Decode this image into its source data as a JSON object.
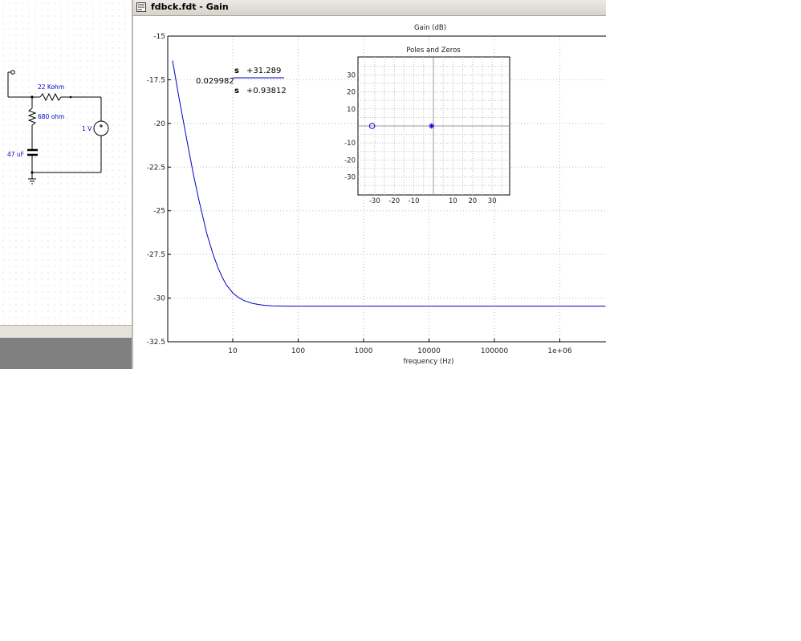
{
  "window": {
    "title": "fdbck.fdt - Gain"
  },
  "schematic": {
    "components": [
      {
        "label": "22 Kohm"
      },
      {
        "label": "680 ohm"
      },
      {
        "label": "47 uF"
      },
      {
        "label": "1 V"
      }
    ]
  },
  "transfer_function": {
    "gain": "0.029982",
    "numerator": {
      "var": "s",
      "term": "+31.289"
    },
    "denominator": {
      "var": "s",
      "term": "+0.93812"
    }
  },
  "colors": {
    "curve": "#0000c8",
    "wire": "#000000",
    "component_label": "#0000cc"
  },
  "chart_data": [
    {
      "type": "line",
      "title": "Gain (dB)",
      "xlabel": "frequency (Hz)",
      "ylabel": "",
      "x_scale": "log",
      "xlim": [
        1.2,
        5000000
      ],
      "ylim": [
        -32.5,
        -15
      ],
      "x_ticks": [
        10,
        100,
        1000,
        10000,
        100000,
        1000000
      ],
      "x_tick_labels": [
        "10",
        "100",
        "1000",
        "10000",
        "100000",
        "1e+06"
      ],
      "y_ticks": [
        -15,
        -17.5,
        -20,
        -22.5,
        -25,
        -27.5,
        -30,
        -32.5
      ],
      "y_tick_labels": [
        "-15",
        "-17.5",
        "-20",
        "-22.5",
        "-25",
        "-27.5",
        "-30",
        "-32.5"
      ],
      "grid": true,
      "series": [
        {
          "x": [
            1.2,
            1.5,
            2,
            2.5,
            3,
            4,
            5,
            6,
            7,
            8,
            10,
            12,
            15,
            20,
            25,
            30,
            40,
            50,
            70,
            100,
            1000,
            10000,
            100000,
            1000000,
            5000000
          ],
          "y": [
            -16.4,
            -18.5,
            -21.0,
            -22.9,
            -24.3,
            -26.3,
            -27.5,
            -28.3,
            -28.85,
            -29.25,
            -29.7,
            -29.95,
            -30.15,
            -30.3,
            -30.37,
            -30.41,
            -30.44,
            -30.45,
            -30.46,
            -30.46,
            -30.46,
            -30.46,
            -30.46,
            -30.46,
            -30.46
          ]
        }
      ]
    },
    {
      "type": "scatter",
      "title": "Poles and Zeros",
      "xlim": [
        -40,
        40
      ],
      "ylim": [
        -40,
        40
      ],
      "x_tick_labels": [
        "-30",
        "-20",
        "-10",
        "10",
        "20",
        "30"
      ],
      "x_ticks": [
        -30,
        -20,
        -10,
        10,
        20,
        30
      ],
      "y_tick_labels": [
        "30",
        "20",
        "10",
        "-10",
        "-20",
        "-30"
      ],
      "y_ticks": [
        30,
        20,
        10,
        -10,
        -20,
        -30
      ],
      "grid": true,
      "points": [
        {
          "kind": "zero",
          "marker": "o",
          "x": -31.289,
          "y": 0
        },
        {
          "kind": "pole",
          "marker": "*",
          "x": -0.93812,
          "y": 0
        }
      ]
    }
  ]
}
